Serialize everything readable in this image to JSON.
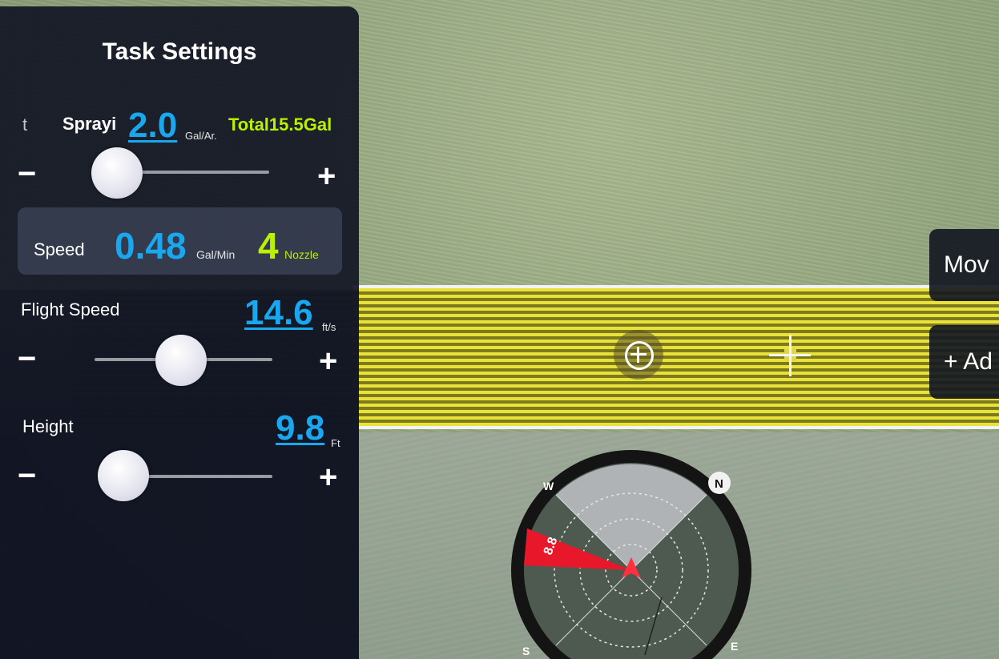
{
  "panel": {
    "title": "Task Settings",
    "spraying": {
      "prefix": "t",
      "label": "Sprayi",
      "value": "2.0",
      "unit": "Gal/Ar.",
      "total": "Total15.5Gal",
      "slider_level": 0.08
    },
    "speed_info": {
      "label": "Speed",
      "flow_value": "0.48",
      "flow_unit": "Gal/Min",
      "nozzle_count": "4",
      "nozzle_label": "Nozzle"
    },
    "flight_speed": {
      "label": "Flight Speed",
      "value": "14.6",
      "unit": "ft/s",
      "slider_level": 0.45
    },
    "height": {
      "label": "Height",
      "value": "9.8",
      "unit": "Ft",
      "slider_level": 0.08
    },
    "minus_symbol": "−",
    "plus_symbol": "+"
  },
  "side_buttons": {
    "move_label": "Mov",
    "add_label": "+  Ad"
  },
  "compass": {
    "north": "N",
    "west": "W",
    "south": "S",
    "east": "E",
    "wind_value": "8.8"
  },
  "colors": {
    "accent_blue": "#19a8f0",
    "accent_green": "#b9f100",
    "route_yellow": "#e8e23a",
    "wind_red": "#e8182a"
  },
  "icons": {
    "center": "target-plus-icon",
    "crosshair": "crosshair-icon",
    "aircraft": "aircraft-arrow-icon"
  }
}
